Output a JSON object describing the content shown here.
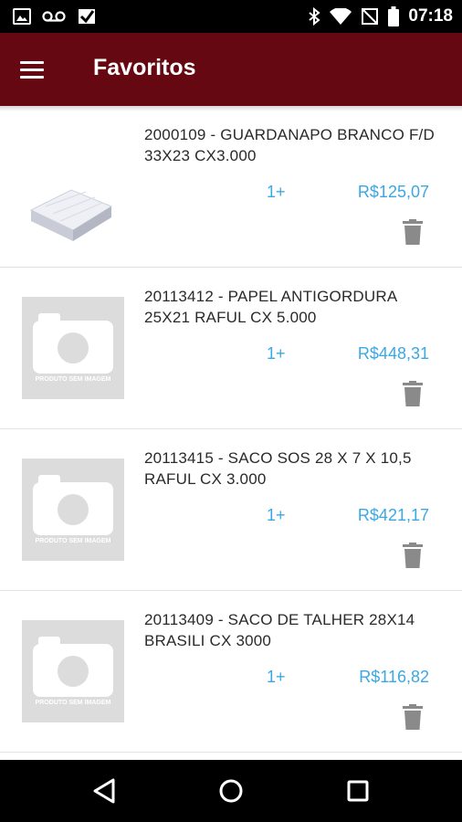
{
  "status_bar": {
    "time": "07:18",
    "left_icons": [
      "image-icon",
      "voicemail-icon",
      "checkmark-icon"
    ],
    "right_icons": [
      "bluetooth-icon",
      "wifi-icon",
      "no-signal-icon",
      "battery-icon"
    ]
  },
  "app_bar": {
    "menu_icon": "hamburger-menu-icon",
    "title": "Favoritos"
  },
  "items": [
    {
      "name": "2000109 - GUARDANAPO BRANCO F/D 33X23 CX3.000",
      "qty": "1+",
      "price": "R$125,07",
      "image": "product-photo",
      "icon": "trash-icon"
    },
    {
      "name": "20113412 - PAPEL ANTIGORDURA 25X21 RAFUL CX 5.000",
      "qty": "1+",
      "price": "R$448,31",
      "image": "placeholder",
      "placeholder_text": "PRODUTO SEM IMAGEM",
      "icon": "trash-icon"
    },
    {
      "name": "20113415 - SACO SOS 28 X 7 X 10,5 RAFUL CX 3.000",
      "qty": "1+",
      "price": "R$421,17",
      "image": "placeholder",
      "placeholder_text": "PRODUTO SEM IMAGEM",
      "icon": "trash-icon"
    },
    {
      "name": "20113409 - SACO DE TALHER 28X14 BRASILI CX 3000",
      "qty": "1+",
      "price": "R$116,82",
      "image": "placeholder",
      "placeholder_text": "PRODUTO SEM IMAGEM",
      "icon": "trash-icon"
    }
  ],
  "nav_bar": {
    "buttons": [
      "back-icon",
      "home-icon",
      "recents-icon"
    ]
  },
  "colors": {
    "app_bar": "#650812",
    "accent_blue": "#3aa8e4",
    "text": "#2a2a2a",
    "icon_gray": "#8a8a8a",
    "placeholder_bg": "#dcdcdc"
  }
}
